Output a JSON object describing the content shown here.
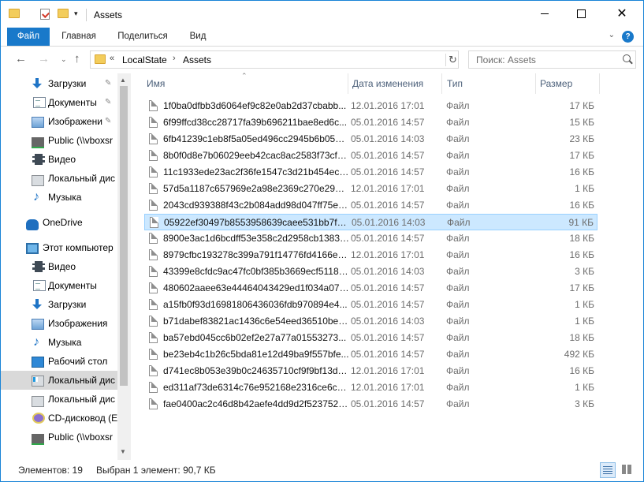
{
  "window": {
    "title": "Assets",
    "controls": {
      "minimize": "–",
      "maximize": "□",
      "close": "✕"
    }
  },
  "ribbon": {
    "tabs": [
      "Файл",
      "Главная",
      "Поделиться",
      "Вид"
    ],
    "help": "?",
    "expand": "⌄"
  },
  "address": {
    "overflow": "«",
    "crumbs": [
      "LocalState",
      "Assets"
    ],
    "separator": "›",
    "refresh": "↻",
    "dropdown": "⌄"
  },
  "search": {
    "placeholder": "Поиск: Assets"
  },
  "nav_pane": {
    "items": [
      {
        "label": "Загрузки",
        "icon": "download-arrow-icon",
        "pinned": true
      },
      {
        "label": "Документы",
        "icon": "documents-icon",
        "pinned": true
      },
      {
        "label": "Изображени",
        "icon": "pictures-icon",
        "pinned": true
      },
      {
        "label": "Public (\\\\vboxsr",
        "icon": "network-drive-icon",
        "pinned": false
      },
      {
        "label": "Видео",
        "icon": "video-icon",
        "pinned": false
      },
      {
        "label": "Локальный дис",
        "icon": "drive-icon",
        "pinned": false
      },
      {
        "label": "Музыка",
        "icon": "music-icon",
        "pinned": false
      },
      {
        "label": "OneDrive",
        "icon": "onedrive-cloud-icon",
        "pinned": false
      },
      {
        "label": "Этот компьютер",
        "icon": "this-pc-icon",
        "pinned": false
      },
      {
        "label": "Видео",
        "icon": "video-icon",
        "pinned": false
      },
      {
        "label": "Документы",
        "icon": "documents-icon",
        "pinned": false
      },
      {
        "label": "Загрузки",
        "icon": "download-arrow-icon",
        "pinned": false
      },
      {
        "label": "Изображения",
        "icon": "pictures-icon",
        "pinned": false
      },
      {
        "label": "Музыка",
        "icon": "music-icon",
        "pinned": false
      },
      {
        "label": "Рабочий стол",
        "icon": "desktop-icon",
        "pinned": false
      },
      {
        "label": "Локальный дис",
        "icon": "windows-drive-icon",
        "pinned": false,
        "selected": true
      },
      {
        "label": "Локальный дис",
        "icon": "drive-icon",
        "pinned": false
      },
      {
        "label": "CD-дисковод (E",
        "icon": "cd-drive-icon",
        "pinned": false
      },
      {
        "label": "Public (\\\\vboxsr",
        "icon": "network-drive-icon",
        "pinned": false
      }
    ],
    "pin_glyph": "📌"
  },
  "columns": {
    "name": "Имя",
    "date": "Дата изменения",
    "type": "Тип",
    "size": "Размер"
  },
  "files": [
    {
      "name": "1f0ba0dfbb3d6064ef9c82e0ab2d37cbabb...",
      "date": "12.01.2016 17:01",
      "type": "Файл",
      "size": "17 КБ"
    },
    {
      "name": "6f99ffcd38cc28717fa39b696211bae8ed6c...",
      "date": "05.01.2016 14:57",
      "type": "Файл",
      "size": "15 КБ"
    },
    {
      "name": "6fb41239c1eb8f5a05ed496cc2945b6b05e9...",
      "date": "05.01.2016 14:03",
      "type": "Файл",
      "size": "23 КБ"
    },
    {
      "name": "8b0f0d8e7b06029eeb42cac8ac2583f73cfb...",
      "date": "05.01.2016 14:57",
      "type": "Файл",
      "size": "17 КБ"
    },
    {
      "name": "11c1933ede23ac2f36fe1547c3d21b454ec1...",
      "date": "05.01.2016 14:57",
      "type": "Файл",
      "size": "16 КБ"
    },
    {
      "name": "57d5a1187c657969e2a98e2369c270e29bf4...",
      "date": "12.01.2016 17:01",
      "type": "Файл",
      "size": "1 КБ"
    },
    {
      "name": "2043cd939388f43c2b084add98d047ff75ec...",
      "date": "05.01.2016 14:57",
      "type": "Файл",
      "size": "16 КБ"
    },
    {
      "name": "05922ef30497b8553958639caee531bb7f80...",
      "date": "05.01.2016 14:03",
      "type": "Файл",
      "size": "91 КБ",
      "selected": true
    },
    {
      "name": "8900e3ac1d6bcdff53e358c2d2958cb1383a...",
      "date": "05.01.2016 14:57",
      "type": "Файл",
      "size": "18 КБ"
    },
    {
      "name": "8979cfbc193278c399a791f14776fd4166e1...",
      "date": "12.01.2016 17:01",
      "type": "Файл",
      "size": "16 КБ"
    },
    {
      "name": "43399e8cfdc9ac47fc0bf385b3669ecf51181...",
      "date": "05.01.2016 14:03",
      "type": "Файл",
      "size": "3 КБ"
    },
    {
      "name": "480602aaee63e44464043429ed1f034a07ba...",
      "date": "05.01.2016 14:57",
      "type": "Файл",
      "size": "17 КБ"
    },
    {
      "name": "a15fb0f93d16981806436036fdb970894e4...",
      "date": "05.01.2016 14:57",
      "type": "Файл",
      "size": "1 КБ"
    },
    {
      "name": "b71dabef83821ac1436c6e54eed36510be6...",
      "date": "05.01.2016 14:03",
      "type": "Файл",
      "size": "1 КБ"
    },
    {
      "name": "ba57ebd045cc6b02ef2e27a77a01553273...",
      "date": "05.01.2016 14:57",
      "type": "Файл",
      "size": "18 КБ"
    },
    {
      "name": "be23eb4c1b26c5bda81e12d49ba9f557bfe...",
      "date": "05.01.2016 14:57",
      "type": "Файл",
      "size": "492 КБ"
    },
    {
      "name": "d741ec8b053e39b0c24635710cf9f9bf13d3...",
      "date": "12.01.2016 17:01",
      "type": "Файл",
      "size": "16 КБ"
    },
    {
      "name": "ed311af73de6314c76e952168e2316ce6c1e...",
      "date": "12.01.2016 17:01",
      "type": "Файл",
      "size": "1 КБ"
    },
    {
      "name": "fae0400ac2c46d8b42aefe4dd9d2f5237521...",
      "date": "05.01.2016 14:57",
      "type": "Файл",
      "size": "3 КБ"
    }
  ],
  "status": {
    "count": "Элементов: 19",
    "selection": "Выбран 1 элемент: 90,7 КБ"
  }
}
